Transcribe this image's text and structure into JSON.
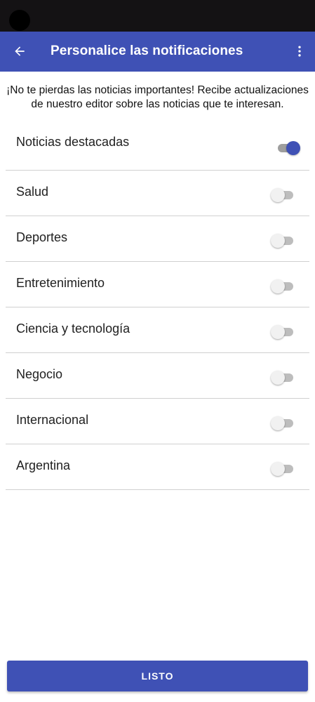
{
  "app_bar": {
    "title": "Personalice las notificaciones",
    "color": "#3f51b5",
    "back_icon": "arrow-back-icon",
    "menu_icon": "more-vert-icon"
  },
  "intro": {
    "line1": "¡No te pierdas las noticias importantes! Recibe actualizaciones",
    "line2": "de nuestro editor sobre las noticias que te interesan."
  },
  "topics": [
    {
      "label": "Noticias destacadas",
      "enabled": true
    },
    {
      "label": "Salud",
      "enabled": false
    },
    {
      "label": "Deportes",
      "enabled": false
    },
    {
      "label": "Entretenimiento",
      "enabled": false
    },
    {
      "label": "Ciencia y tecnología",
      "enabled": false
    },
    {
      "label": "Negocio",
      "enabled": false
    },
    {
      "label": "Internacional",
      "enabled": false
    },
    {
      "label": "Argentina",
      "enabled": false
    }
  ],
  "done_button": {
    "label": "LISTO"
  }
}
